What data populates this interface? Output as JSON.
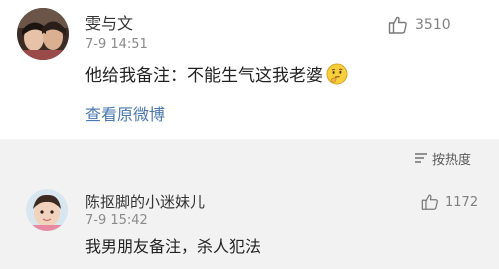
{
  "post": {
    "username": "雯与文",
    "timestamp": "7-9 14:51",
    "like_count": "3510",
    "text": "他给我备注：不能生气这我老婆",
    "emoji": "thinking-face-emoji",
    "view_original_label": "查看原微博"
  },
  "sort": {
    "label": "按热度"
  },
  "comment": {
    "username": "陈抠脚的小迷妹儿",
    "timestamp": "7-9 15:42",
    "like_count": "1172",
    "text": "我男朋友备注，杀人犯法"
  },
  "colors": {
    "link": "#4a78b0",
    "meta": "#8a8a8a",
    "section_background": "#f2f2f2"
  },
  "icons": [
    "thumbs-up-icon",
    "sort-lines-icon",
    "thinking-face-emoji"
  ]
}
